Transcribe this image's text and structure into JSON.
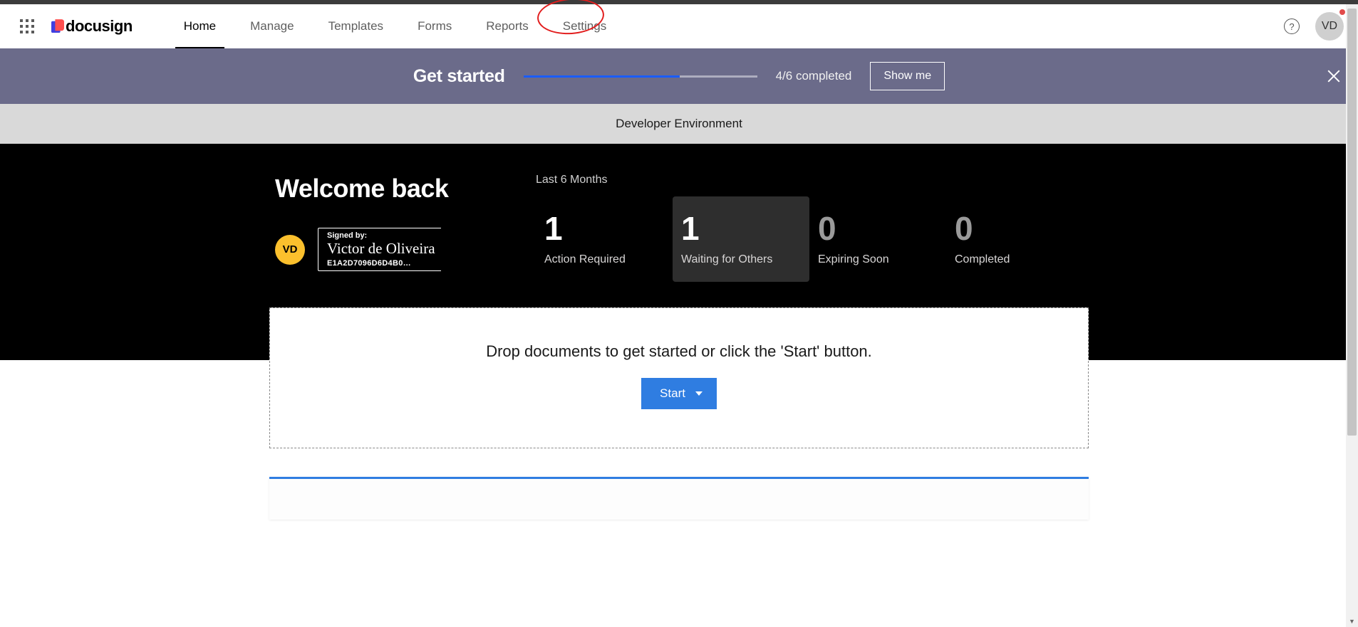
{
  "brand": {
    "name": "docusign"
  },
  "nav": {
    "items": [
      {
        "label": "Home",
        "active": true
      },
      {
        "label": "Manage",
        "active": false
      },
      {
        "label": "Templates",
        "active": false
      },
      {
        "label": "Forms",
        "active": false
      },
      {
        "label": "Reports",
        "active": false
      },
      {
        "label": "Settings",
        "active": false
      }
    ]
  },
  "user": {
    "initials": "VD"
  },
  "banner": {
    "title": "Get started",
    "completed": 4,
    "total": 6,
    "status_text": "4/6 completed",
    "button": "Show me",
    "progress_pct": 67
  },
  "dev_env": {
    "label": "Developer Environment"
  },
  "welcome": {
    "title": "Welcome back",
    "avatar_initials": "VD",
    "signed_by_label": "Signed by:",
    "signature_name": "Victor de Oliveira",
    "signature_id": "E1A2D7096D6D4B0…"
  },
  "stats": {
    "range_label": "Last 6 Months",
    "cards": [
      {
        "value": "1",
        "label": "Action Required",
        "muted": false,
        "hovered": false
      },
      {
        "value": "1",
        "label": "Waiting for Others",
        "muted": false,
        "hovered": true
      },
      {
        "value": "0",
        "label": "Expiring Soon",
        "muted": true,
        "hovered": false
      },
      {
        "value": "0",
        "label": "Completed",
        "muted": true,
        "hovered": false
      }
    ]
  },
  "dropzone": {
    "text": "Drop documents to get started or click the 'Start' button.",
    "button": "Start"
  },
  "annotation": {
    "circle_target": "Settings"
  }
}
